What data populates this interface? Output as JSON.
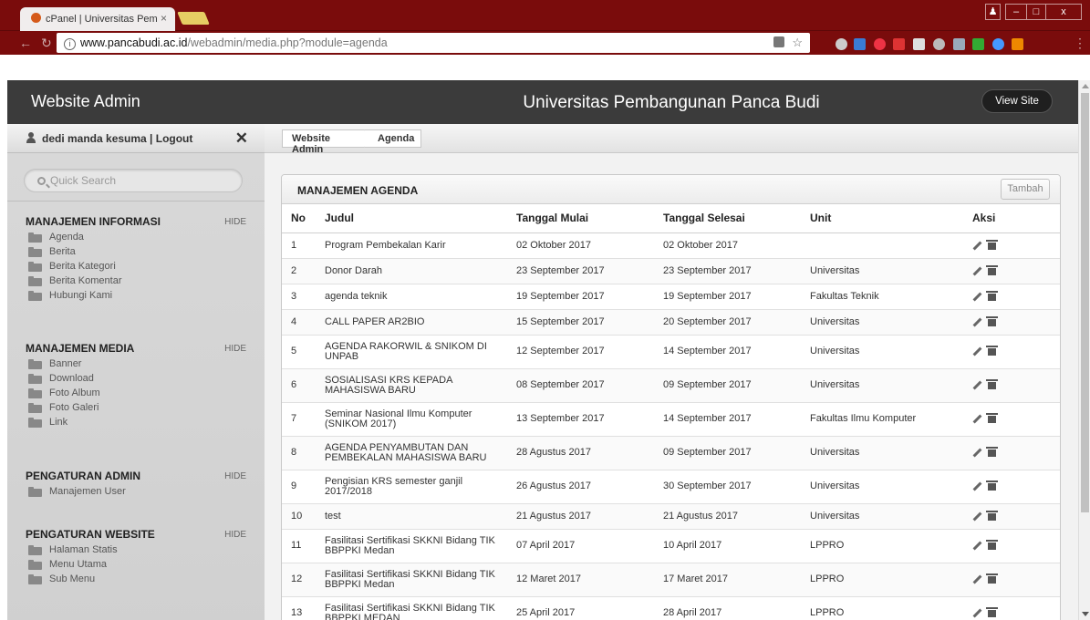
{
  "browser": {
    "tab_title": "cPanel | Universitas Pem",
    "url_domain": "www.pancabudi.ac.id",
    "url_path": "/webadmin/media.php?module=agenda"
  },
  "sidebar": {
    "title": "Website Admin",
    "user_text": "dedi manda kesuma | Logout",
    "search_placeholder": "Quick Search",
    "sections": [
      {
        "title": "MANAJEMEN INFORMASI",
        "hide": "HIDE",
        "items": [
          "Agenda",
          "Berita",
          "Berita Kategori",
          "Berita Komentar",
          "Hubungi Kami"
        ]
      },
      {
        "title": "MANAJEMEN MEDIA",
        "hide": "HIDE",
        "items": [
          "Banner",
          "Download",
          "Foto Album",
          "Foto Galeri",
          "Link"
        ]
      },
      {
        "title": "PENGATURAN ADMIN",
        "hide": "HIDE",
        "items": [
          "Manajemen User"
        ]
      },
      {
        "title": "PENGATURAN WEBSITE",
        "hide": "HIDE",
        "items": [
          "Halaman Statis",
          "Menu Utama",
          "Sub Menu"
        ]
      }
    ]
  },
  "header": {
    "title": "Universitas Pembangunan Panca Budi",
    "view_site": "View Site"
  },
  "breadcrumb": [
    "Website Admin",
    "Agenda"
  ],
  "panel": {
    "title": "MANAJEMEN AGENDA",
    "add_button": "Tambah",
    "columns": [
      "No",
      "Judul",
      "Tanggal Mulai",
      "Tanggal Selesai",
      "Unit",
      "Aksi"
    ],
    "rows": [
      [
        "1",
        "Program Pembekalan Karir",
        "02 Oktober 2017",
        "02 Oktober 2017",
        ""
      ],
      [
        "2",
        "Donor Darah",
        "23 September 2017",
        "23 September 2017",
        "Universitas"
      ],
      [
        "3",
        "agenda teknik",
        "19 September 2017",
        "19 September 2017",
        "Fakultas Teknik"
      ],
      [
        "4",
        "CALL PAPER AR2BIO",
        "15 September 2017",
        "20 September 2017",
        "Universitas"
      ],
      [
        "5",
        "AGENDA RAKORWIL & SNIKOM DI UNPAB",
        "12 September 2017",
        "14 September 2017",
        "Universitas"
      ],
      [
        "6",
        "SOSIALISASI KRS KEPADA MAHASISWA BARU",
        "08 September 2017",
        "09 September 2017",
        "Universitas"
      ],
      [
        "7",
        "Seminar Nasional Ilmu Komputer (SNIKOM 2017)",
        "13 September 2017",
        "14 September 2017",
        "Fakultas Ilmu Komputer"
      ],
      [
        "8",
        "AGENDA PENYAMBUTAN DAN PEMBEKALAN MAHASISWA BARU",
        "28 Agustus 2017",
        "09 September 2017",
        "Universitas"
      ],
      [
        "9",
        "Pengisian KRS semester ganjil 2017/2018",
        "26 Agustus 2017",
        "30 September 2017",
        "Universitas"
      ],
      [
        "10",
        "test",
        "21 Agustus 2017",
        "21 Agustus 2017",
        "Universitas"
      ],
      [
        "11",
        "Fasilitasi Sertifikasi SKKNI Bidang TIK BBPPKI Medan",
        "07 April 2017",
        "10 April 2017",
        "LPPRO"
      ],
      [
        "12",
        "Fasilitasi Sertifikasi SKKNI Bidang TIK BBPPKI Medan",
        "12 Maret 2017",
        "17 Maret 2017",
        "LPPRO"
      ],
      [
        "13",
        "Fasilitasi Sertifikasi SKKNI Bidang TIK BBPPKI MEDAN",
        "25 April 2017",
        "28 April 2017",
        "LPPRO"
      ]
    ],
    "tall_rows": [
      5,
      6,
      7,
      8,
      9,
      11,
      12,
      13
    ]
  }
}
